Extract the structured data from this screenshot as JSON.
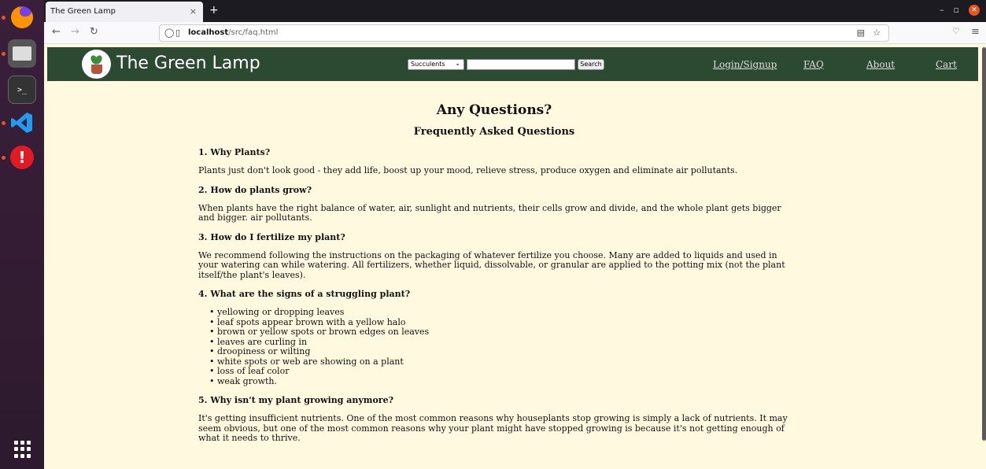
{
  "browser": {
    "tab_title": "The Green Lamp",
    "tab_close": "×",
    "new_tab": "+",
    "url_host": "localhost",
    "url_path": "/src/faq.html"
  },
  "site": {
    "title": "The Green Lamp",
    "category_selected": "Succulents",
    "search_label": "Search",
    "nav": [
      "Login/Signup",
      "FAQ",
      "About",
      "Cart"
    ]
  },
  "faq": {
    "heading": "Any Questions?",
    "subheading": "Frequently Asked Questions",
    "items": [
      {
        "q": "1. Why Plants?",
        "a": "Plants just don't look good - they add life, boost up your mood, relieve stress, produce oxygen and eliminate air pollutants."
      },
      {
        "q": "2. How do plants grow?",
        "a": "When plants have the right balance of water, air, sunlight and nutrients, their cells grow and divide, and the whole plant gets bigger and bigger. air pollutants."
      },
      {
        "q": "3. How do I fertilize my plant?",
        "a": "We recommend following the instructions on the packaging of whatever fertilize you choose. Many are added to liquids and used in your watering can while watering. All fertilizers, whether liquid, dissolvable, or granular are applied to the potting mix (not the plant itself/the plant's leaves)."
      },
      {
        "q": "4. What are the signs of a struggling plant?",
        "list": [
          "yellowing or dropping leaves",
          "leaf spots appear brown with a yellow halo",
          "brown or yellow spots or brown edges on leaves",
          "leaves are curling in",
          "droopiness or wilting",
          "white spots or web are showing on a plant",
          "loss of leaf color",
          "weak growth."
        ]
      },
      {
        "q": "5. Why isn't my plant growing anymore?",
        "a": "It's getting insufficient nutrients. One of the most common reasons why houseplants stop growing is simply a lack of nutrients. It may seem obvious, but one of the most common reasons why your plant might have stopped growing is because it's not getting enough of what it needs to thrive."
      }
    ]
  },
  "colors": {
    "header_bg": "#2c4a32",
    "page_bg": "#fffadf",
    "accent": "#e95420"
  }
}
